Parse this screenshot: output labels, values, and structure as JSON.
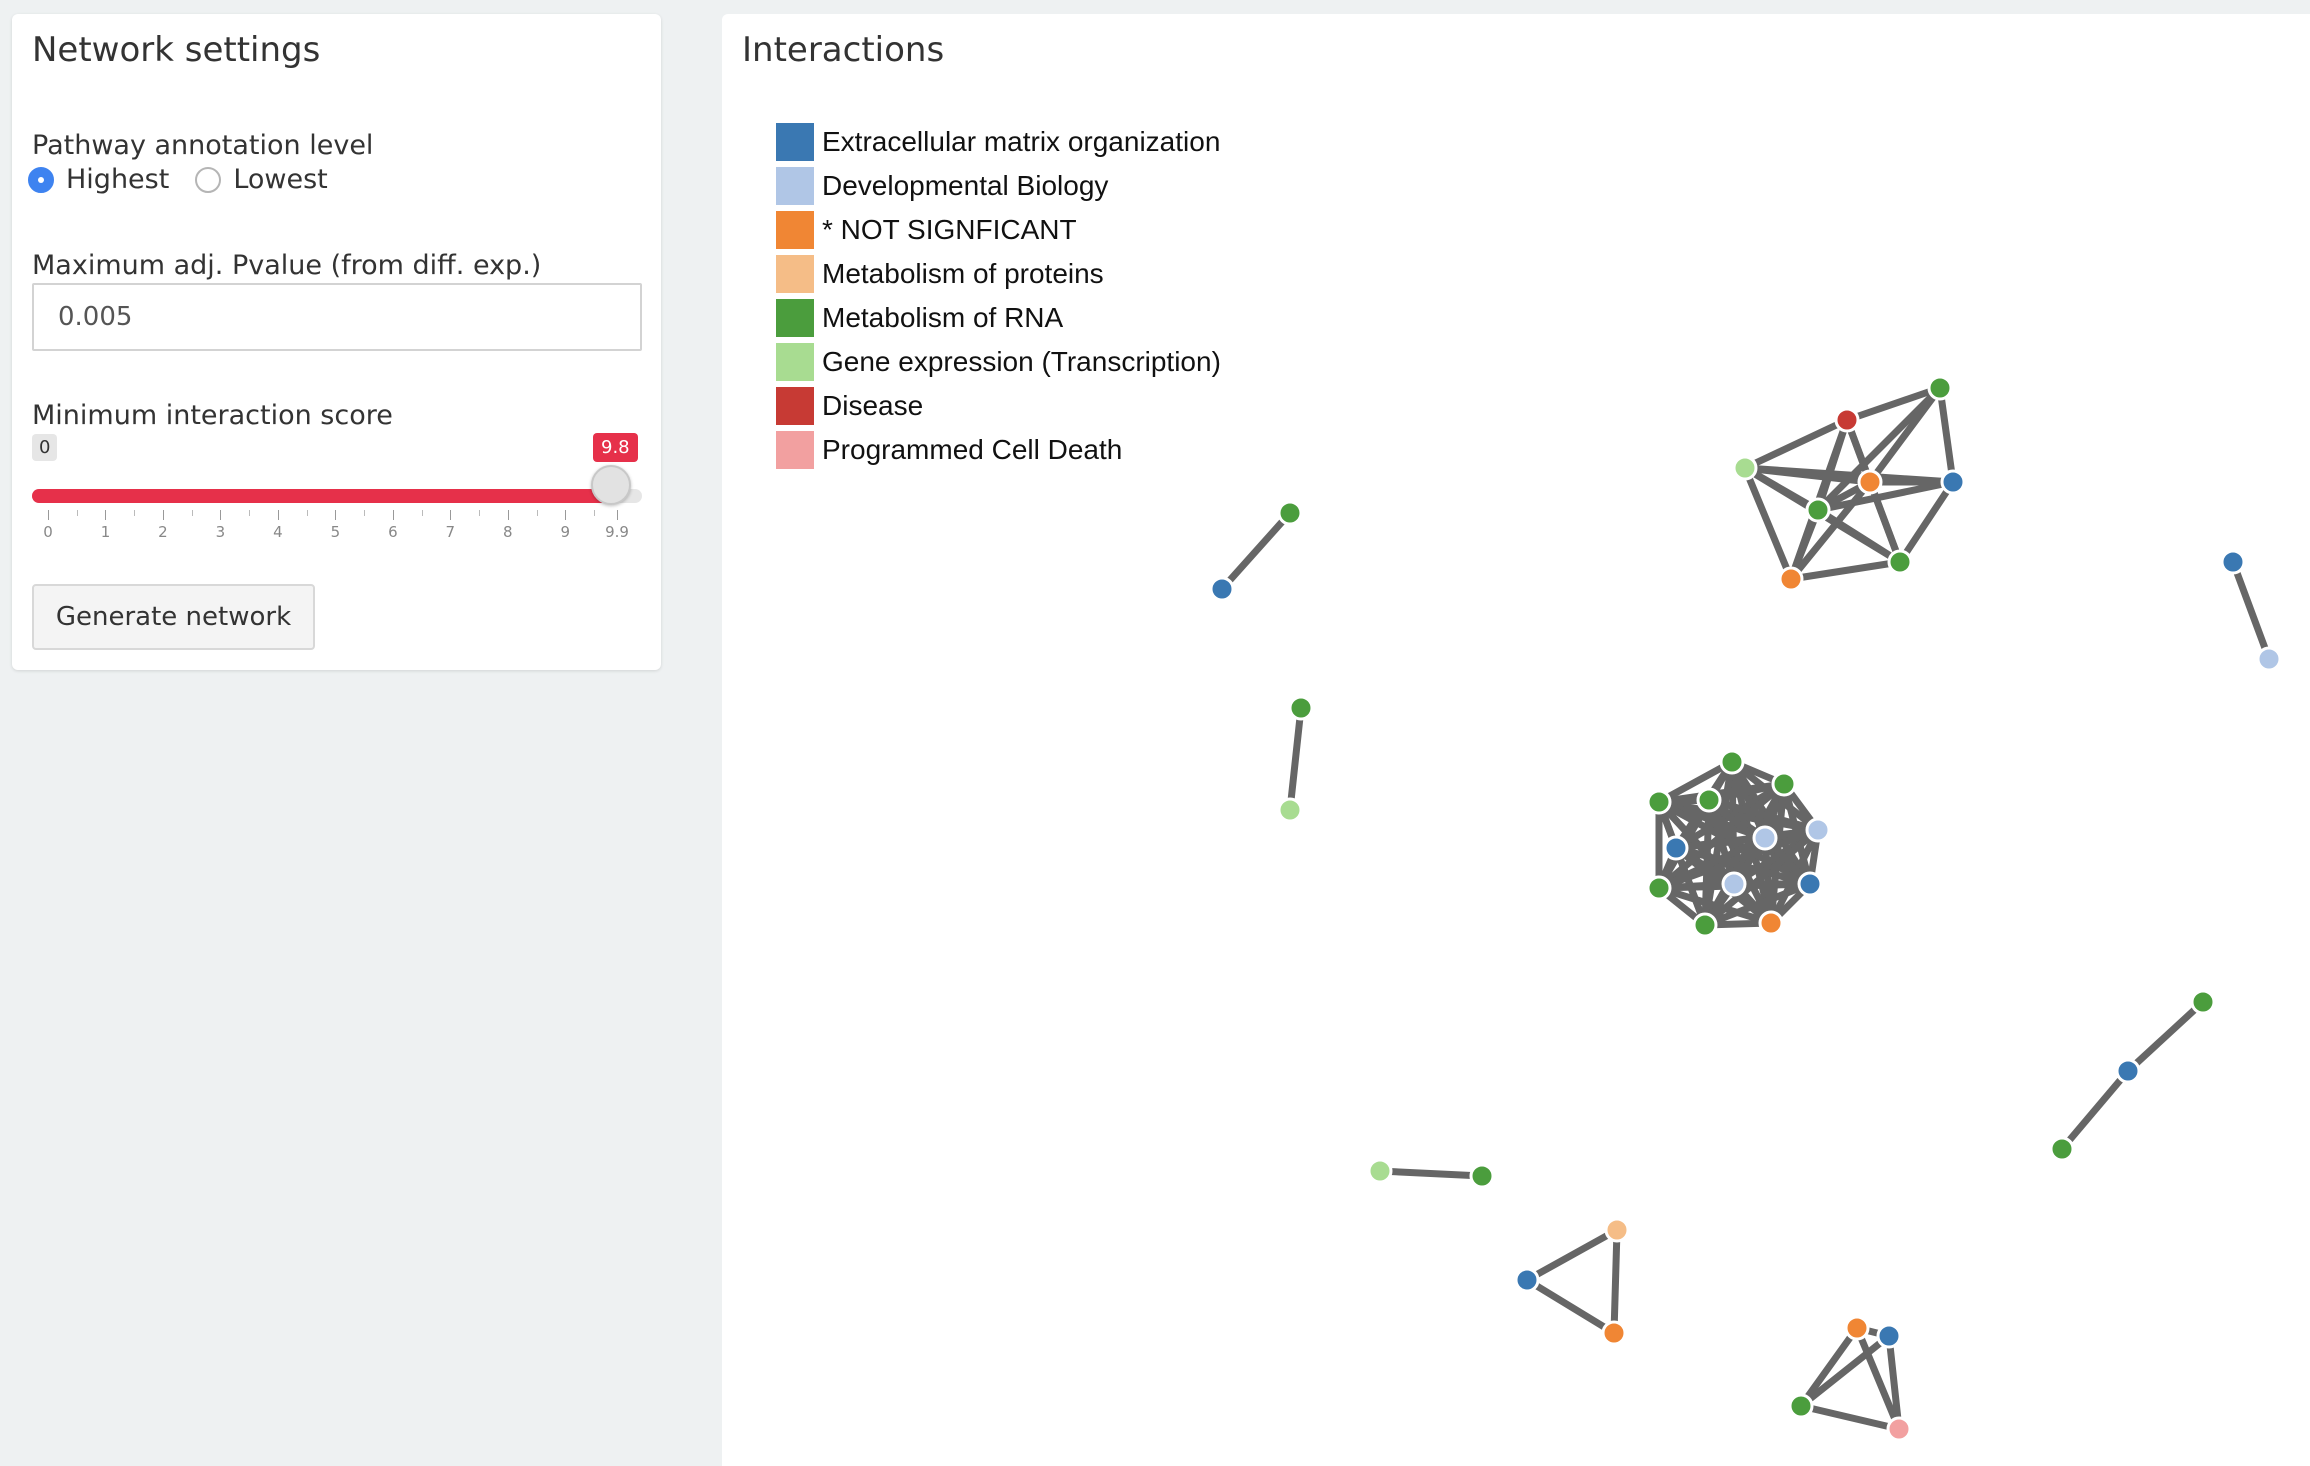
{
  "settings": {
    "title": "Network settings",
    "pathway_label": "Pathway annotation level",
    "pathway_options": [
      {
        "label": "Highest",
        "checked": true
      },
      {
        "label": "Lowest",
        "checked": false
      }
    ],
    "pvalue_label": "Maximum adj. Pvalue (from diff. exp.)",
    "pvalue_value": "0.005",
    "score_label": "Minimum interaction score",
    "score_slider": {
      "min_label": "0",
      "value_label": "9.8",
      "min": 0,
      "max": 9.9,
      "value": 9.8,
      "tick_labels": [
        "0",
        "1",
        "2",
        "3",
        "4",
        "5",
        "6",
        "7",
        "8",
        "9",
        "9.9"
      ],
      "accent_color": "#e6304a"
    },
    "generate_button_label": "Generate network"
  },
  "interactions": {
    "title": "Interactions",
    "legend": [
      {
        "label": "Extracellular matrix organization",
        "color": "#3a78b2"
      },
      {
        "label": "Developmental Biology",
        "color": "#b0c6e6"
      },
      {
        "label": "* NOT SIGNFICANT",
        "color": "#f08634"
      },
      {
        "label": "Metabolism of proteins",
        "color": "#f5bd87"
      },
      {
        "label": "Metabolism of RNA",
        "color": "#4b9d3d"
      },
      {
        "label": "Gene expression (Transcription)",
        "color": "#a8dc91"
      },
      {
        "label": "Disease",
        "color": "#c73a34"
      },
      {
        "label": "Programmed Cell Death",
        "color": "#f2a0a0"
      }
    ]
  }
}
